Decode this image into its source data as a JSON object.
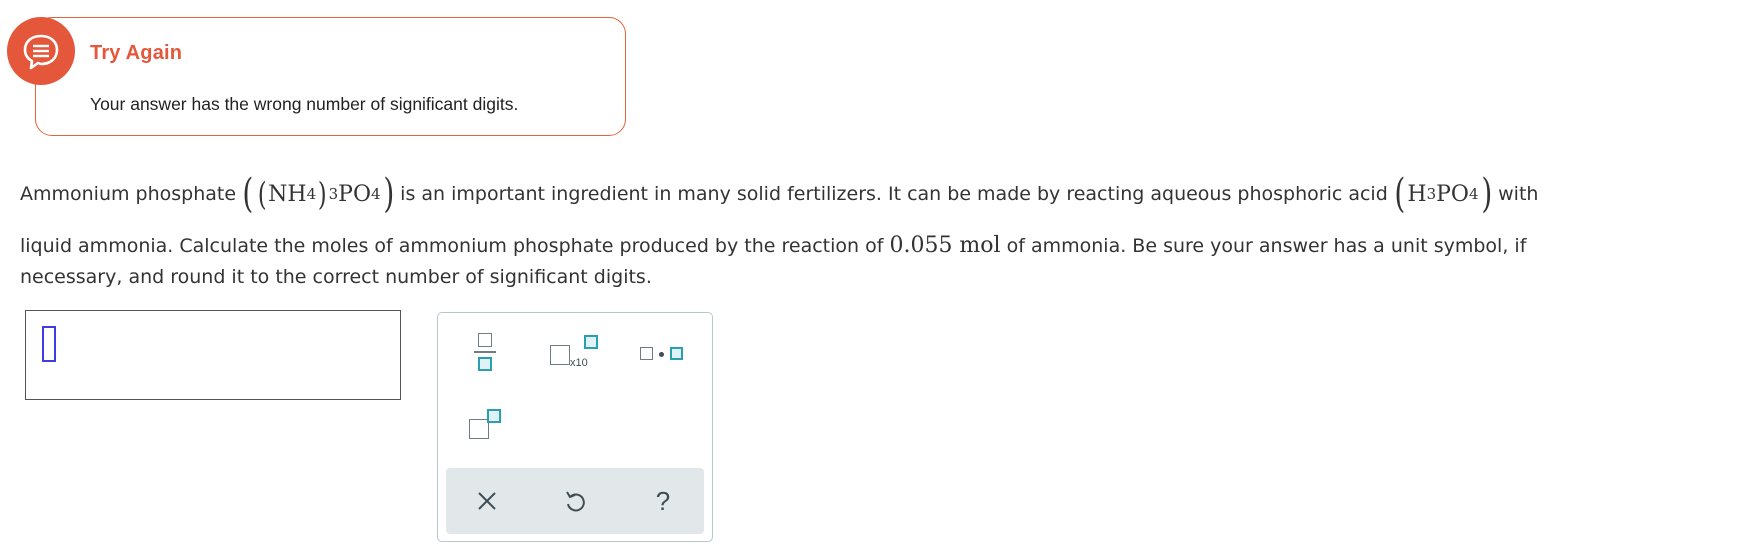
{
  "feedback": {
    "title": "Try Again",
    "message": "Your answer has the wrong number of significant digits.",
    "icon": "chat-bubble-icon",
    "accent": "#e5573a"
  },
  "question": {
    "intro": "Ammonium phosphate",
    "formula_ammonium_phosphate": {
      "nh": "NH",
      "nh_sub": "4",
      "group_sub": "3",
      "po": "PO",
      "po_sub": "4"
    },
    "mid1": "is an important ingredient in many solid fertilizers. It can be made by reacting aqueous phosphoric acid",
    "formula_phosphoric_acid": {
      "h": "H",
      "h_sub": "3",
      "po": "PO",
      "po_sub": "4"
    },
    "with": "with",
    "line2_a": "liquid ammonia. Calculate the moles of ammonium phosphate produced by the reaction of",
    "quantity": "0.055 mol",
    "line2_b": "of ammonia. Be sure your answer has a unit symbol, if",
    "line3": "necessary, and round it to the correct number of significant digits."
  },
  "answer": {
    "value": ""
  },
  "keypad": {
    "keys": [
      "fraction-key",
      "scientific-notation-key",
      "multiplication-dot-key",
      "superscript-key"
    ],
    "x10_label": "x10",
    "footer": {
      "clear_icon": "close-icon",
      "undo_icon": "undo-icon",
      "help_label": "?"
    },
    "accent": "#2a9fb0"
  }
}
